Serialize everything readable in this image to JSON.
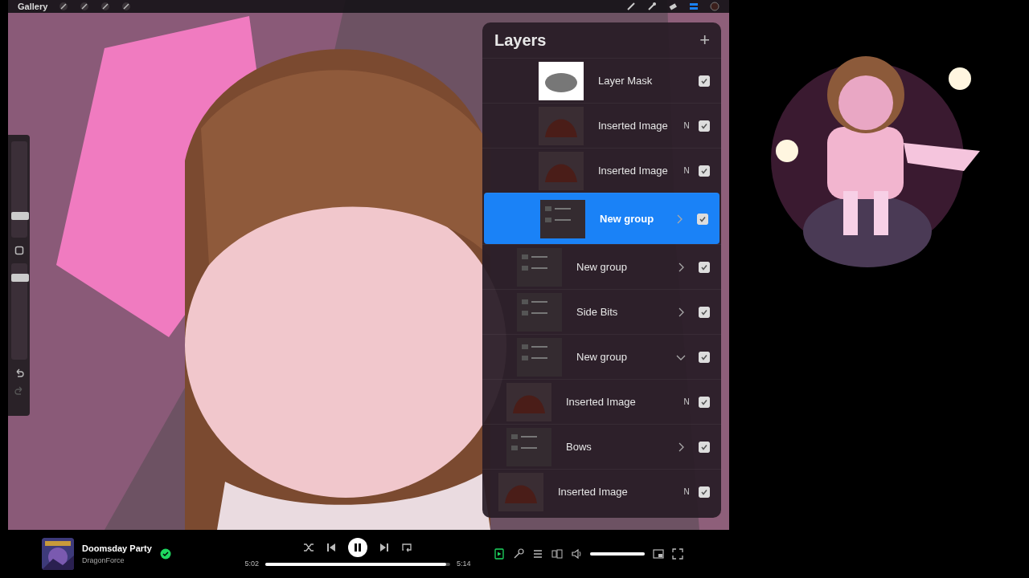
{
  "app_toolbar": {
    "gallery": "Gallery"
  },
  "sidebar": {
    "brush_size": {
      "level": 0.2
    },
    "opacity": {
      "level": 0.88
    }
  },
  "layers_panel": {
    "title": "Layers",
    "add": "+",
    "layers": [
      {
        "name": "Layer Mask",
        "kind": "mask",
        "visible": true,
        "selected": false
      },
      {
        "name": "Inserted Image",
        "blend": "N",
        "visible": true,
        "selected": false
      },
      {
        "name": "Inserted Image",
        "blend": "N",
        "visible": true,
        "selected": false
      },
      {
        "name": "New group",
        "kind": "group",
        "expanded": false,
        "visible": true,
        "selected": true
      },
      {
        "name": "New group",
        "kind": "group",
        "expanded": false,
        "visible": true,
        "selected": false
      },
      {
        "name": "Side Bits",
        "kind": "group",
        "expanded": false,
        "visible": true,
        "selected": false
      },
      {
        "name": "New group",
        "kind": "group",
        "expanded": true,
        "visible": true,
        "selected": false
      },
      {
        "name": "Inserted Image",
        "blend": "N",
        "visible": true,
        "selected": false
      },
      {
        "name": "Bows",
        "kind": "group",
        "expanded": false,
        "visible": true,
        "selected": false
      },
      {
        "name": "Inserted Image",
        "blend": "N",
        "visible": true,
        "selected": false
      }
    ]
  },
  "player": {
    "title": "Doomsday Party",
    "artist": "DragonForce",
    "liked": true,
    "playing": true,
    "elapsed": "5:02",
    "duration": "5:14",
    "progress": {
      "level": 0.98
    },
    "now_playing_view": true,
    "volume": {
      "level": 1.0
    }
  }
}
